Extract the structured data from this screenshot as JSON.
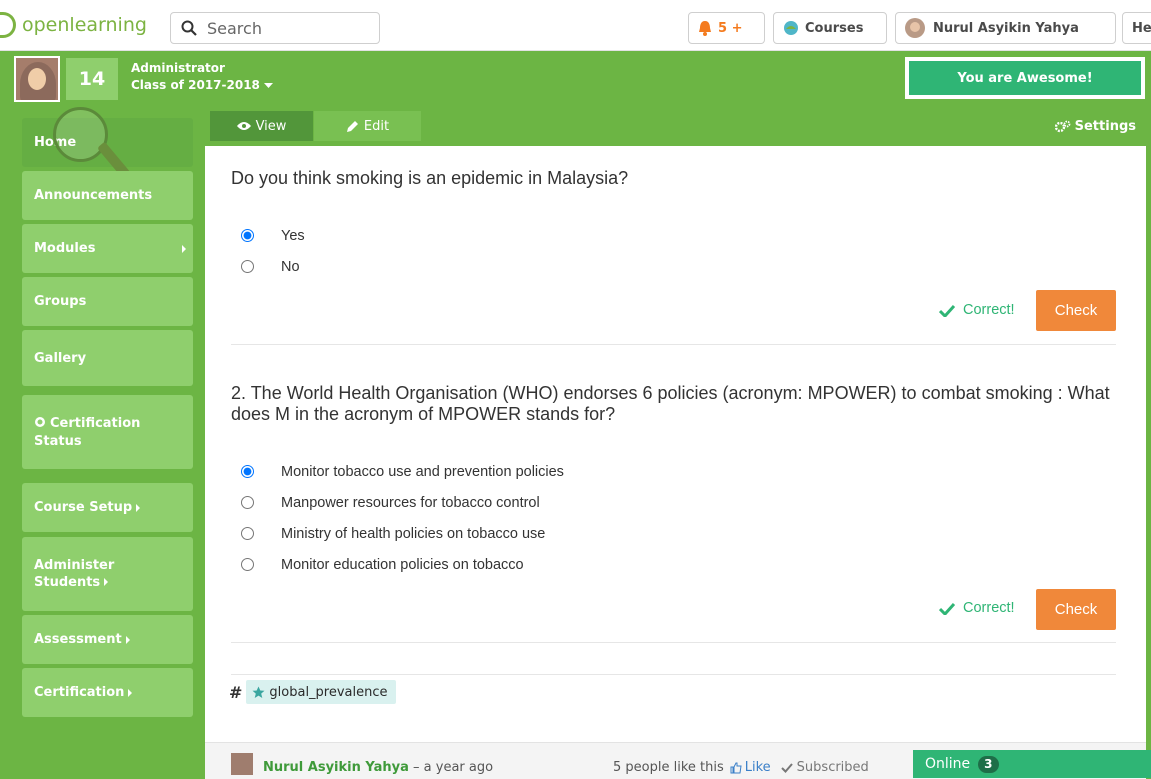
{
  "navbar": {
    "logo_text": "openlearning",
    "search_placeholder": "Search",
    "notifications_label": "5 +",
    "courses_label": "Courses",
    "user_label": "Nurul Asyikin Yahya",
    "help_label": "He",
    "icons": {
      "search": "search-icon",
      "notifications": "bell-icon",
      "courses": "courses-icon"
    },
    "accent": "#f47b1f"
  },
  "profile": {
    "level": "14",
    "role": "Administrator",
    "class_label": "Class of 2017-2018",
    "badge_text": "You are Awesome!"
  },
  "sidebar": {
    "items": [
      {
        "label": "Home"
      },
      {
        "label": "Announcements"
      },
      {
        "label": "Modules"
      },
      {
        "label": "Groups"
      },
      {
        "label": "Gallery"
      },
      {
        "label": "Certification Status"
      },
      {
        "label": "Course Setup"
      },
      {
        "label": "Administer Students"
      },
      {
        "label": "Assessment"
      },
      {
        "label": "Certification"
      }
    ]
  },
  "tabs": {
    "view_label": "View",
    "edit_label": "Edit",
    "settings_label": "Settings"
  },
  "questions": [
    {
      "title": "Do you think smoking is an epidemic in Malaysia?",
      "options": [
        "Yes",
        "No"
      ],
      "selected_index": 0,
      "feedback": "Correct!",
      "check_label": "Check"
    },
    {
      "title": "2. The World Health Organisation (WHO) endorses 6 policies (acronym: MPOWER) to combat smoking : What does M in the acronym of MPOWER stands for?",
      "options": [
        "Monitor tobacco use and prevention policies",
        "Manpower resources for tobacco control",
        "Ministry of health policies on tobacco use",
        "Monitor education policies on tobacco"
      ],
      "selected_index": 0,
      "feedback": "Correct!",
      "check_label": "Check"
    }
  ],
  "tag": {
    "hash": "#",
    "label": "global_prevalence"
  },
  "footer": {
    "author": "Nurul Asyikin Yahya",
    "time": "– a year ago",
    "likes_text": "5 people like this",
    "like_label": "Like",
    "subscribed_label": "Subscribed"
  },
  "online": {
    "label": "Online",
    "count": "3"
  },
  "colors": {
    "brand_green": "#6cb544",
    "sidebar_item": "#8fcf6d",
    "success": "#2fb575",
    "check_button": "#f0883a"
  }
}
